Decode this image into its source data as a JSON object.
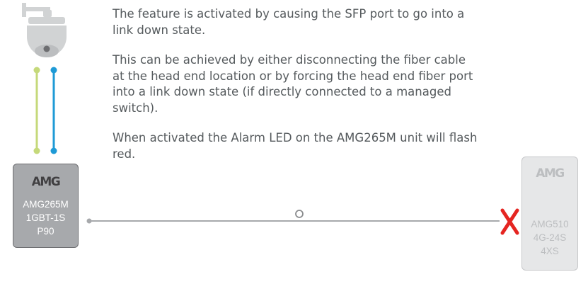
{
  "paragraphs": [
    "The feature is activated by causing the SFP port to go into a link down state.",
    "This can be achieved by either disconnecting the fiber cable at the head end location or by forcing the head end fiber port into a link down state (if directly connected to a managed switch).",
    "When activated the Alarm LED on the AMG265M unit will flash red."
  ],
  "left_device": {
    "logo": "AMG",
    "model_lines": [
      "AMG265M",
      "1GBT-1S",
      "P90"
    ]
  },
  "right_device": {
    "logo": "AMG",
    "model_lines": [
      "AMG510",
      "4G-24S",
      "4XS"
    ]
  },
  "colors": {
    "fiber_green": "#c5d97a",
    "fiber_blue": "#1e9ad6",
    "link_line": "#a7a9ac",
    "fault_x": "#e52521",
    "camera": "#d1d3d4"
  },
  "icons": [
    "dome-camera-icon",
    "link-down-x-icon"
  ]
}
